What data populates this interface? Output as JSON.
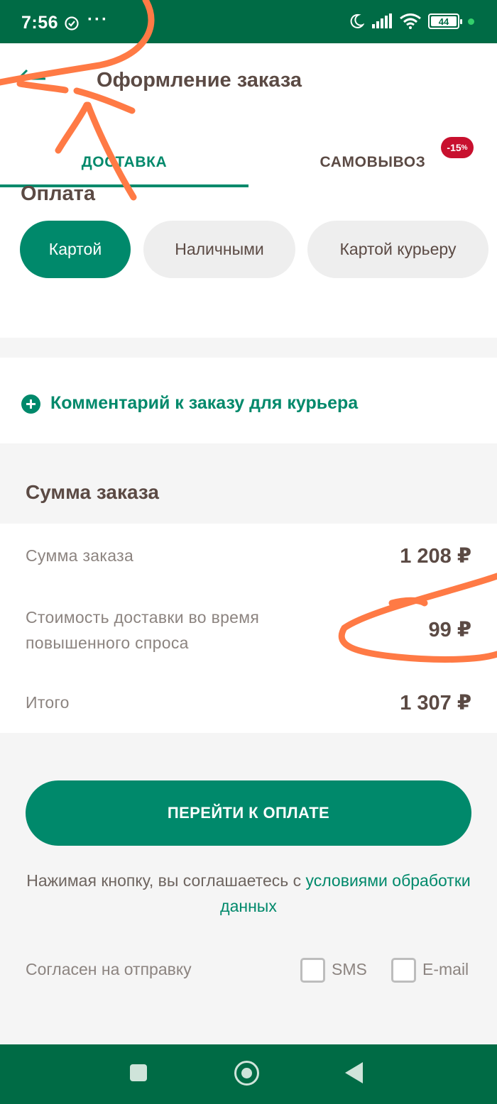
{
  "status_bar": {
    "time": "7:56",
    "dots": "···",
    "battery": "44"
  },
  "header": {
    "title": "Оформление заказа"
  },
  "tabs": [
    {
      "label": "ДОСТАВКА",
      "active": true
    },
    {
      "label": "САМОВЫВОЗ",
      "active": false,
      "badge": "-15",
      "badge_suffix": "%"
    }
  ],
  "payment": {
    "heading": "Оплата",
    "options": [
      {
        "label": "Картой",
        "selected": true
      },
      {
        "label": "Наличными",
        "selected": false
      },
      {
        "label": "Картой курьеру",
        "selected": false
      }
    ]
  },
  "comment": {
    "label": "Комментарий к заказу для курьера"
  },
  "summary": {
    "heading": "Сумма заказа",
    "rows": [
      {
        "label": "Сумма заказа",
        "value": "1 208 ₽"
      },
      {
        "label": "Стоимость доставки во время повышенного спроса",
        "value": "99 ₽"
      },
      {
        "label": "Итого",
        "value": "1 307 ₽"
      }
    ]
  },
  "checkout": {
    "button_label": "ПЕРЕЙТИ К ОПЛАТЕ",
    "agreement_text": "Нажимая кнопку, вы соглашаетесь с ",
    "agreement_link": "условиями обработки данных"
  },
  "consent": {
    "label": "Согласен на отправку",
    "options": [
      {
        "label": "SMS",
        "checked": false
      },
      {
        "label": "E-mail",
        "checked": false
      }
    ]
  },
  "colors": {
    "brand_dark": "#006b45",
    "accent": "#00896b",
    "text": "#5b4a44",
    "badge": "#c8102e",
    "annotation": "#ff7a45"
  }
}
